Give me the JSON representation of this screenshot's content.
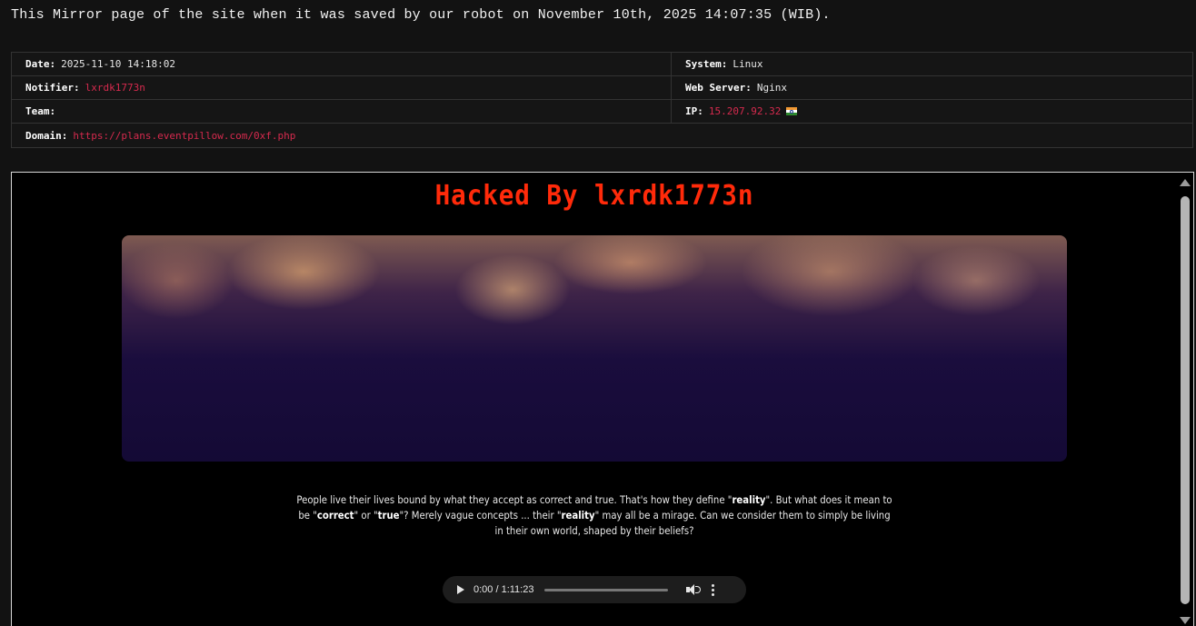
{
  "banner": "This Mirror page of the site when it was saved by our robot on November 10th, 2025 14:07:35 (WIB).",
  "info": {
    "date_label": "Date:",
    "date": "2025-11-10 14:18:02",
    "system_label": "System:",
    "system": "Linux",
    "notifier_label": "Notifier:",
    "notifier": "lxrdk1773n",
    "webserver_label": "Web Server:",
    "webserver": "Nginx",
    "team_label": "Team:",
    "team": "",
    "ip_label": "IP:",
    "ip": "15.207.92.32",
    "ip_flag_icon": "india-flag-icon",
    "domain_label": "Domain:",
    "domain": "https://plans.eventpillow.com/0xf.php"
  },
  "mirror": {
    "title": "Hacked By lxrdk1773n",
    "quote": {
      "p1": "People live their lives bound by what they accept as correct and true. That's how they define \"",
      "w1": "reality",
      "p2": "\". But what does it mean to be \"",
      "w2": "correct",
      "p3": "\" or \"",
      "w3": "true",
      "p4": "\"? Merely vague concepts ... their \"",
      "w4": "reality",
      "p5": "\" may all be a mirage. Can we consider them to simply be living in their own world, shaped by their beliefs?"
    },
    "audio": {
      "time": "0:00 / 1:11:23",
      "progress": 0
    }
  },
  "colors": {
    "accent_red": "#d62a4e",
    "title_red": "#ff2a0a",
    "background": "#121212"
  }
}
